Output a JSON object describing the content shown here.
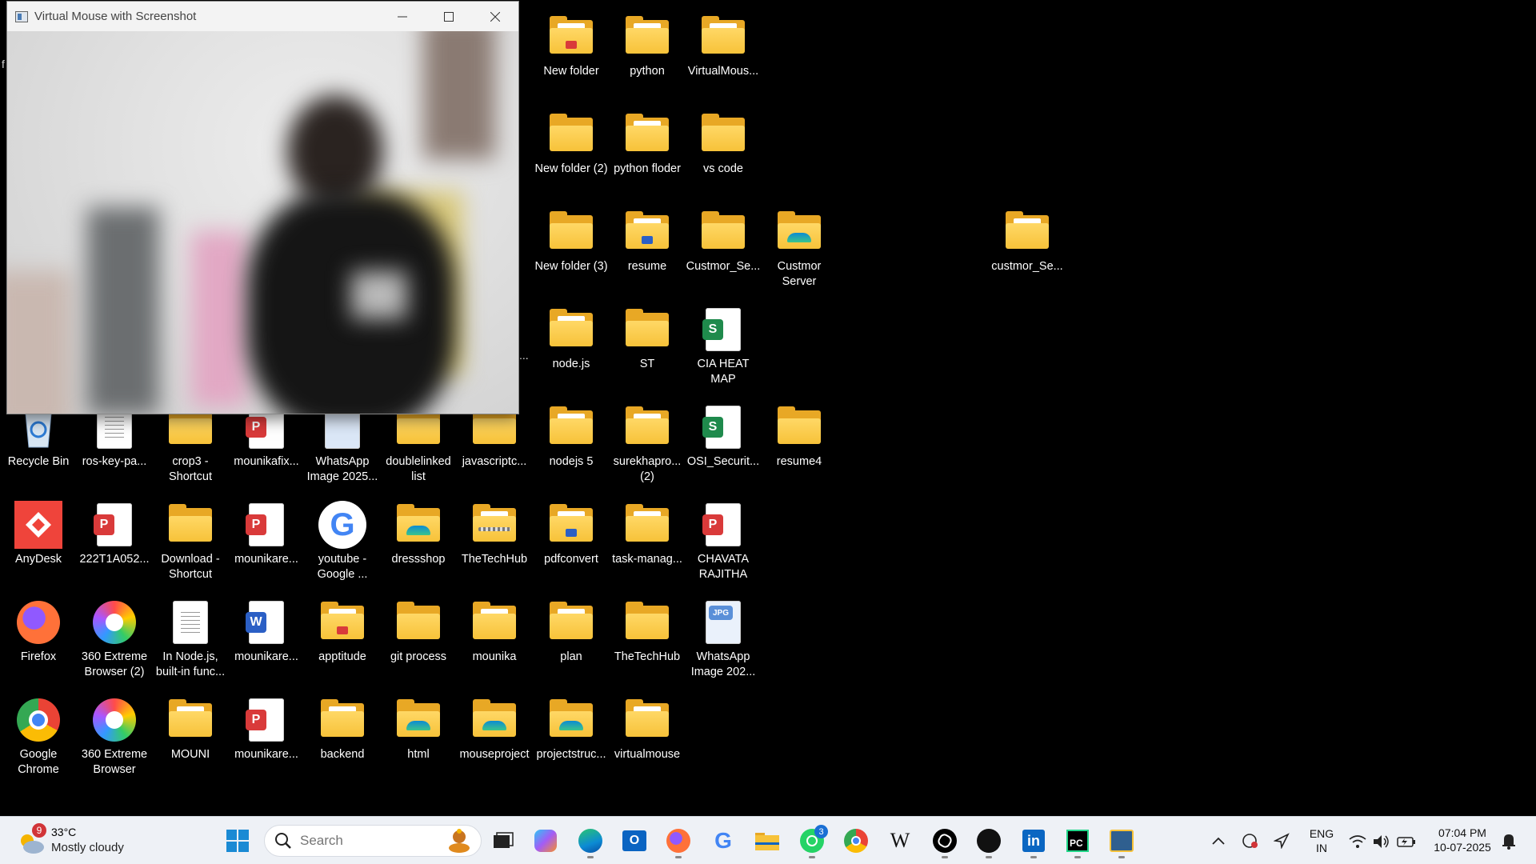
{
  "window": {
    "title": "Virtual Mouse with Screenshot",
    "minimize_icon": "minimize-icon",
    "maximize_icon": "maximize-icon",
    "close_icon": "close-icon"
  },
  "desktop": {
    "partial_left_label": "f",
    "partial_mid_label": "...",
    "icons": [
      {
        "label": "New folder",
        "kind": "folder",
        "mark": "pdf"
      },
      {
        "label": "python",
        "kind": "folder",
        "mark": "doc"
      },
      {
        "label": "VirtualMous...",
        "kind": "folder",
        "mark": "doc"
      },
      {
        "label": "New folder (2)",
        "kind": "folder"
      },
      {
        "label": "python floder",
        "kind": "folder",
        "mark": "doc"
      },
      {
        "label": "vs code",
        "kind": "folder"
      },
      {
        "label": "New folder (3)",
        "kind": "folder"
      },
      {
        "label": "resume",
        "kind": "folder",
        "mark": "word"
      },
      {
        "label": "Custmor_Se...",
        "kind": "folder"
      },
      {
        "label": "Custmor Server",
        "kind": "folder",
        "mark": "edge"
      },
      {
        "label": "custmor_Se...",
        "kind": "folder",
        "mark": "doc"
      },
      {
        "label": "node.js",
        "kind": "folder",
        "mark": "doc"
      },
      {
        "label": "ST",
        "kind": "folder"
      },
      {
        "label": "CIA HEAT MAP",
        "kind": "sheet",
        "badge": "S"
      },
      {
        "label": "Recycle Bin",
        "kind": "recycle"
      },
      {
        "label": "ros-key-pa...",
        "kind": "text"
      },
      {
        "label": "crop3 - Shortcut",
        "kind": "folder"
      },
      {
        "label": "mounikafix...",
        "kind": "pdf"
      },
      {
        "label": "WhatsApp Image 2025...",
        "kind": "image"
      },
      {
        "label": "doublelinked list",
        "kind": "folder"
      },
      {
        "label": "javascriptc...",
        "kind": "folder"
      },
      {
        "label": "nodejs 5",
        "kind": "folder",
        "mark": "doc"
      },
      {
        "label": "surekhapro... (2)",
        "kind": "folder",
        "mark": "doc"
      },
      {
        "label": "OSI_Securit...",
        "kind": "sheet",
        "badge": "S"
      },
      {
        "label": "resume4",
        "kind": "folder"
      },
      {
        "label": "AnyDesk",
        "kind": "anydesk"
      },
      {
        "label": "222T1A052...",
        "kind": "pdf"
      },
      {
        "label": "Download - Shortcut",
        "kind": "folder"
      },
      {
        "label": "mounikare...",
        "kind": "pdf"
      },
      {
        "label": "youtube - Google ...",
        "kind": "google",
        "glyph": "G"
      },
      {
        "label": "dressshop",
        "kind": "folder",
        "mark": "edge"
      },
      {
        "label": "TheTechHub",
        "kind": "folder",
        "mark": "zip"
      },
      {
        "label": "pdfconvert",
        "kind": "folder",
        "mark": "word"
      },
      {
        "label": "task-manag...",
        "kind": "folder",
        "mark": "doc"
      },
      {
        "label": "CHAVATA RAJITHA",
        "kind": "pdf"
      },
      {
        "label": "Firefox",
        "kind": "firefox"
      },
      {
        "label": "360 Extreme Browser (2)",
        "kind": "b360"
      },
      {
        "label": "In Node.js, built-in func...",
        "kind": "text"
      },
      {
        "label": "mounikare...",
        "kind": "word",
        "badge": "W"
      },
      {
        "label": "apptitude",
        "kind": "folder",
        "mark": "pdf"
      },
      {
        "label": "git process",
        "kind": "folder"
      },
      {
        "label": "mounika",
        "kind": "folder",
        "mark": "doc"
      },
      {
        "label": "plan",
        "kind": "folder",
        "mark": "doc"
      },
      {
        "label": "TheTechHub",
        "kind": "folder"
      },
      {
        "label": "WhatsApp Image 202...",
        "kind": "jpg",
        "badge": "JPG"
      },
      {
        "label": "Google Chrome",
        "kind": "chrome"
      },
      {
        "label": "360 Extreme Browser",
        "kind": "b360"
      },
      {
        "label": "MOUNI",
        "kind": "folder",
        "mark": "doc"
      },
      {
        "label": "mounikare...",
        "kind": "pdf"
      },
      {
        "label": "backend",
        "kind": "folder",
        "mark": "doc"
      },
      {
        "label": "html",
        "kind": "folder",
        "mark": "edge"
      },
      {
        "label": "mouseproject",
        "kind": "folder",
        "mark": "edge"
      },
      {
        "label": "projectstruc...",
        "kind": "folder",
        "mark": "edge"
      },
      {
        "label": "virtualmouse",
        "kind": "folder",
        "mark": "doc"
      }
    ]
  },
  "taskbar": {
    "weather": {
      "temp": "33°C",
      "condition": "Mostly cloudy",
      "badge": "9"
    },
    "search": {
      "placeholder": "Search"
    },
    "apps": [
      {
        "name": "start",
        "icon": "windows-start-icon"
      },
      {
        "name": "task-view",
        "icon": "task-view-icon"
      },
      {
        "name": "copilot",
        "icon": "copilot-icon"
      },
      {
        "name": "edge",
        "icon": "edge-icon"
      },
      {
        "name": "outlook",
        "icon": "outlook-icon"
      },
      {
        "name": "firefox",
        "icon": "firefox-icon"
      },
      {
        "name": "google",
        "icon": "google-icon",
        "glyph": "G"
      },
      {
        "name": "file-explorer",
        "icon": "folder-icon"
      },
      {
        "name": "whatsapp",
        "icon": "whatsapp-icon",
        "badge": "3"
      },
      {
        "name": "chrome",
        "icon": "chrome-icon"
      },
      {
        "name": "wikipedia",
        "icon": "wikipedia-icon",
        "glyph": "W"
      },
      {
        "name": "chatgpt",
        "icon": "chatgpt-icon"
      },
      {
        "name": "github",
        "icon": "github-icon"
      },
      {
        "name": "linkedin",
        "icon": "linkedin-icon",
        "glyph": "in"
      },
      {
        "name": "pycharm",
        "icon": "pycharm-icon",
        "glyph": "PC"
      },
      {
        "name": "python",
        "icon": "python-icon"
      }
    ],
    "tray": {
      "language": "ENG",
      "region": "IN",
      "time": "07:04 PM",
      "date": "10-07-2025"
    }
  },
  "colors": {
    "folder": "#f7c239",
    "taskbar": "#eef1f6",
    "pdf_red": "#d93a3a",
    "sheet_green": "#1f8a4c",
    "word_blue": "#2b5fc5"
  }
}
